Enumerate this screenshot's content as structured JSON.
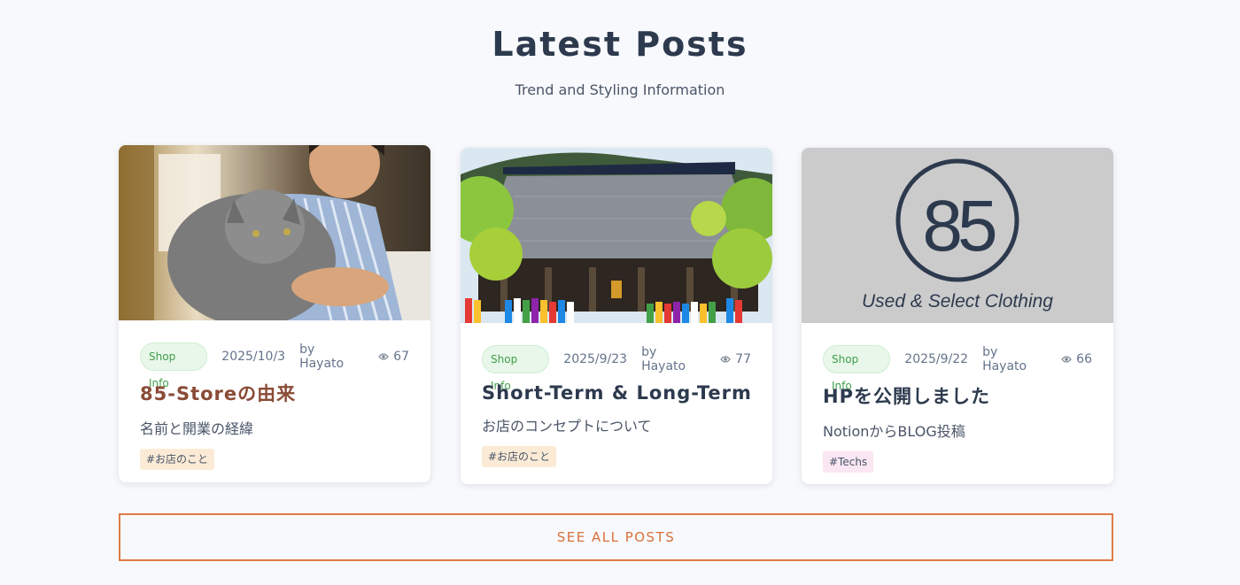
{
  "header": {
    "title": "Latest Posts",
    "subtitle": "Trend and Styling Information"
  },
  "posts": [
    {
      "category": "Shop Info",
      "date": "2025/10/3",
      "author": "by Hayato",
      "views": "67",
      "title": "85-Storeの由来",
      "excerpt": "名前と開業の経緯",
      "tag": "#お店のこと",
      "image_icon": "photo-boy-with-cat"
    },
    {
      "category": "Shop Info",
      "date": "2025/9/23",
      "author": "by Hayato",
      "views": "77",
      "title": "Short-Term & Long-Term",
      "excerpt": "お店のコンセプトについて",
      "tag": "#お店のこと",
      "image_icon": "photo-temple"
    },
    {
      "category": "Shop Info",
      "date": "2025/9/22",
      "author": "by Hayato",
      "views": "66",
      "title": "HPを公開しました",
      "excerpt": "NotionからBLOG投稿",
      "tag": "#Techs",
      "image_icon": "logo-85",
      "logo_mark": "85",
      "logo_caption": "Used & Select Clothing"
    }
  ],
  "see_all_label": "SEE ALL POSTS",
  "colors": {
    "background": "#f7f9fc",
    "title": "#2d3a4e",
    "accent_orange": "#e07b45",
    "featured_title": "#8a4b37",
    "badge_green": "#3f9e4a",
    "tag_orange_bg": "#fbebd6",
    "tag_pink_bg": "#fbe6f3"
  }
}
